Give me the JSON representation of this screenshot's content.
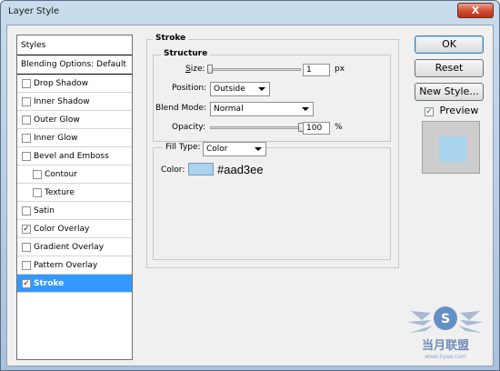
{
  "window": {
    "title": "Layer Style",
    "close_label": "X"
  },
  "styles_panel": {
    "header": "Styles",
    "blending": "Blending Options: Default",
    "items": [
      {
        "label": "Drop Shadow",
        "checked": false,
        "sub": false,
        "selected": false
      },
      {
        "label": "Inner Shadow",
        "checked": false,
        "sub": false,
        "selected": false
      },
      {
        "label": "Outer Glow",
        "checked": false,
        "sub": false,
        "selected": false
      },
      {
        "label": "Inner Glow",
        "checked": false,
        "sub": false,
        "selected": false
      },
      {
        "label": "Bevel and Emboss",
        "checked": false,
        "sub": false,
        "selected": false
      },
      {
        "label": "Contour",
        "checked": false,
        "sub": true,
        "selected": false
      },
      {
        "label": "Texture",
        "checked": false,
        "sub": true,
        "selected": false
      },
      {
        "label": "Satin",
        "checked": false,
        "sub": false,
        "selected": false
      },
      {
        "label": "Color Overlay",
        "checked": true,
        "sub": false,
        "selected": false
      },
      {
        "label": "Gradient Overlay",
        "checked": false,
        "sub": false,
        "selected": false
      },
      {
        "label": "Pattern Overlay",
        "checked": false,
        "sub": false,
        "selected": false
      },
      {
        "label": "Stroke",
        "checked": true,
        "sub": false,
        "selected": true
      }
    ]
  },
  "stroke": {
    "group_title": "Stroke",
    "structure_title": "Structure",
    "size_label": "Size:",
    "size_value": "1",
    "size_unit": "px",
    "size_fraction": 0.0,
    "position_label": "Position:",
    "position_value": "Outside",
    "blend_label": "Blend Mode:",
    "blend_value": "Normal",
    "opacity_label": "Opacity:",
    "opacity_value": "100",
    "opacity_unit": "%",
    "opacity_fraction": 1.0,
    "fill_type_label": "Fill Type:",
    "fill_type_value": "Color",
    "color_label": "Color:",
    "color_hex": "#aad3ee"
  },
  "buttons": {
    "ok": "OK",
    "reset": "Reset",
    "new_style": "New Style...",
    "preview": "Preview",
    "preview_checked": true
  },
  "colors": {
    "selection": "#3399ff",
    "stroke_color": "#aad3ee",
    "preview_bg": "#cdcdcd"
  },
  "watermark": {
    "text": "当月联盟",
    "url": "www.5yae.com",
    "logo_letter": "S"
  }
}
